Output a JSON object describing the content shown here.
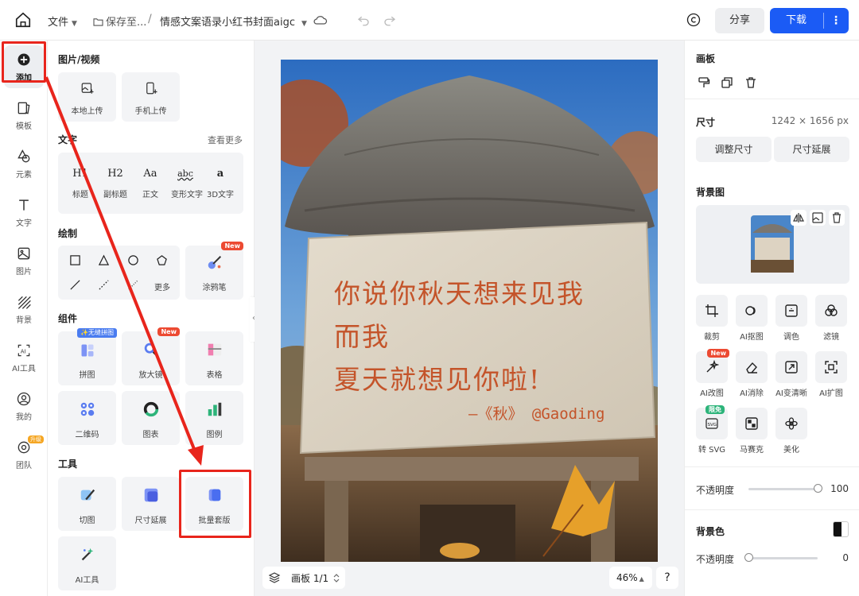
{
  "topbar": {
    "file_label": "文件",
    "save_label": "保存至...",
    "path_sep": "/",
    "doc_title": "情感文案语录小红书封面aigc",
    "share_label": "分享",
    "download_label": "下载",
    "more_glyph": "⋮"
  },
  "rail": {
    "items": [
      {
        "label": "添加",
        "icon": "plus-circle-icon"
      },
      {
        "label": "模板",
        "icon": "template-icon"
      },
      {
        "label": "元素",
        "icon": "shapes-icon"
      },
      {
        "label": "文字",
        "icon": "text-icon"
      },
      {
        "label": "图片",
        "icon": "image-icon"
      },
      {
        "label": "背景",
        "icon": "background-icon"
      },
      {
        "label": "AI工具",
        "icon": "ai-icon"
      },
      {
        "label": "我的",
        "icon": "user-icon"
      },
      {
        "label": "团队",
        "icon": "team-icon"
      }
    ],
    "team_badge": "升级"
  },
  "panel": {
    "media": {
      "title": "图片/视频",
      "local_upload": "本地上传",
      "phone_upload": "手机上传"
    },
    "text": {
      "title": "文字",
      "see_more": "查看更多",
      "items": [
        {
          "glyph": "H1",
          "label": "标题"
        },
        {
          "glyph": "H2",
          "label": "副标题"
        },
        {
          "glyph": "Aa",
          "label": "正文"
        },
        {
          "glyph": "abc",
          "label": "变形文字"
        },
        {
          "glyph": "a",
          "label": "3D文字"
        }
      ]
    },
    "draw": {
      "title": "绘制",
      "more_label": "更多",
      "brush_label": "涂鸦笔",
      "new_badge": "New"
    },
    "components": {
      "title": "组件",
      "items": [
        {
          "label": "拼图",
          "badge": "✨无缝拼图"
        },
        {
          "label": "放大镜",
          "badge": "New"
        },
        {
          "label": "表格"
        },
        {
          "label": "二维码"
        },
        {
          "label": "图表"
        },
        {
          "label": "图例"
        }
      ]
    },
    "tools": {
      "title": "工具",
      "items": [
        {
          "label": "切图"
        },
        {
          "label": "尺寸延展"
        },
        {
          "label": "批量套版"
        },
        {
          "label": "AI工具"
        }
      ]
    },
    "collapse_glyph": "‹"
  },
  "canvas": {
    "poem_line1": "你说你秋天想来见我",
    "poem_line2": "而我",
    "poem_line3": "夏天就想见你啦!",
    "signature": "—《秋》 @Gaoding",
    "page_label": "画板 1/1",
    "zoom": "46%",
    "help": "?"
  },
  "right": {
    "board_title": "画板",
    "size_title": "尺寸",
    "size_value": "1242 × 1656 px",
    "resize_btn": "调整尺寸",
    "extend_btn": "尺寸延展",
    "bg_image_title": "背景图",
    "tools": [
      {
        "label": "裁剪"
      },
      {
        "label": "AI抠图"
      },
      {
        "label": "调色"
      },
      {
        "label": "滤镜"
      },
      {
        "label": "AI改图",
        "badge": "New"
      },
      {
        "label": "AI消除"
      },
      {
        "label": "AI变清晰"
      },
      {
        "label": "AI扩图"
      },
      {
        "label": "转 SVG",
        "badge": "限免"
      },
      {
        "label": "马赛克"
      },
      {
        "label": "美化"
      }
    ],
    "opacity_label": "不透明度",
    "opacity_value": "100",
    "opacity_fraction": 1.0,
    "bg_color_title": "背景色",
    "bg_opacity_label": "不透明度",
    "bg_opacity_value": "0",
    "bg_opacity_fraction": 0.0
  },
  "colors": {
    "accent": "#1b5bf5",
    "highlight_red": "#e8251c",
    "poem_text": "#c4542a"
  }
}
